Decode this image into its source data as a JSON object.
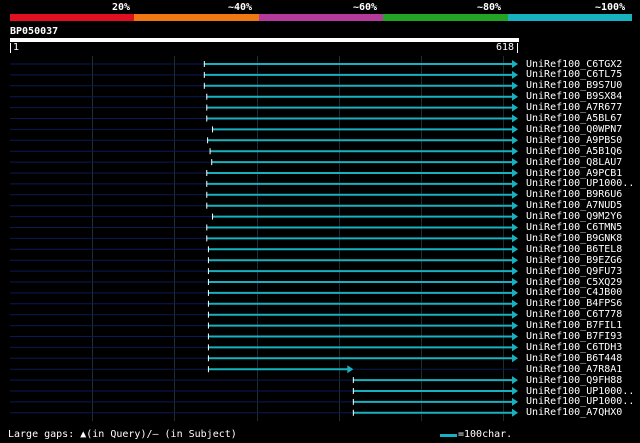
{
  "percent_scale": {
    "labels": [
      "20%",
      "~40%",
      "~60%",
      "~80%",
      "~100%"
    ],
    "colors": [
      "#e01020",
      "#f07812",
      "#b43b9c",
      "#23a425",
      "#17b1c0"
    ]
  },
  "query": {
    "id": "BP050037",
    "start": "1",
    "end": "618"
  },
  "colors": {
    "hit_line": "#17b1c0",
    "unaligned_line": "#0a1a55",
    "grid": "#1c2d33"
  },
  "hits": [
    {
      "name": "UniRef100_C6TGX2",
      "start": 237,
      "end": 618
    },
    {
      "name": "UniRef100_C6TL75",
      "start": 237,
      "end": 618
    },
    {
      "name": "UniRef100_B9S7U0",
      "start": 237,
      "end": 618
    },
    {
      "name": "UniRef100_B9SX84",
      "start": 240,
      "end": 618
    },
    {
      "name": "UniRef100_A7R677",
      "start": 240,
      "end": 618
    },
    {
      "name": "UniRef100_A5BL67",
      "start": 240,
      "end": 618
    },
    {
      "name": "UniRef100_Q0WPN7",
      "start": 247,
      "end": 618
    },
    {
      "name": "UniRef100_A9PBS0",
      "start": 241,
      "end": 618
    },
    {
      "name": "UniRef100_A5B1Q6",
      "start": 244,
      "end": 618
    },
    {
      "name": "UniRef100_Q8LAU7",
      "start": 246,
      "end": 618
    },
    {
      "name": "UniRef100_A9PCB1",
      "start": 240,
      "end": 618
    },
    {
      "name": "UniRef100_UP1000..",
      "start": 240,
      "end": 618
    },
    {
      "name": "UniRef100_B9R6U6",
      "start": 240,
      "end": 618
    },
    {
      "name": "UniRef100_A7NUD5",
      "start": 240,
      "end": 618
    },
    {
      "name": "UniRef100_Q9M2Y6",
      "start": 247,
      "end": 618
    },
    {
      "name": "UniRef100_C6TMN5",
      "start": 240,
      "end": 618
    },
    {
      "name": "UniRef100_B9GNK8",
      "start": 240,
      "end": 618
    },
    {
      "name": "UniRef100_B6TEL8",
      "start": 242,
      "end": 618
    },
    {
      "name": "UniRef100_B9EZG6",
      "start": 242,
      "end": 618
    },
    {
      "name": "UniRef100_Q9FU73",
      "start": 242,
      "end": 618
    },
    {
      "name": "UniRef100_C5XQ29",
      "start": 242,
      "end": 618
    },
    {
      "name": "UniRef100_C4JB00",
      "start": 242,
      "end": 618
    },
    {
      "name": "UniRef100_B4FPS6",
      "start": 242,
      "end": 618
    },
    {
      "name": "UniRef100_C6T778",
      "start": 242,
      "end": 618
    },
    {
      "name": "UniRef100_B7FIL1",
      "start": 242,
      "end": 618
    },
    {
      "name": "UniRef100_B7FI93",
      "start": 242,
      "end": 618
    },
    {
      "name": "UniRef100_C6TDH3",
      "start": 242,
      "end": 618
    },
    {
      "name": "UniRef100_B6T448",
      "start": 242,
      "end": 618
    },
    {
      "name": "UniRef100_A7R8A1",
      "start": 242,
      "end": 418
    },
    {
      "name": "UniRef100_Q9FH88",
      "start": 418,
      "end": 618
    },
    {
      "name": "UniRef100_UP1000..",
      "start": 418,
      "end": 618
    },
    {
      "name": "UniRef100_UP1000..",
      "start": 418,
      "end": 618
    },
    {
      "name": "UniRef100_A7QHX0",
      "start": 418,
      "end": 618
    }
  ],
  "footer": {
    "gaps_text": "Large gaps: ▲(in Query)/– (in Subject)",
    "legend_text": "=100char."
  }
}
